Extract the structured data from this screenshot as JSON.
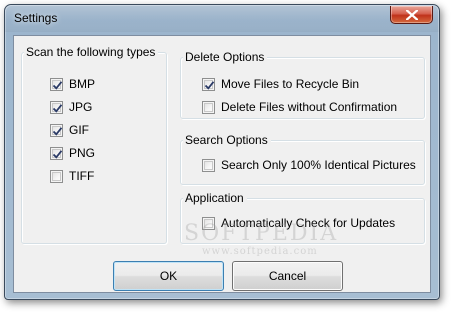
{
  "window": {
    "title": "Settings"
  },
  "types_group": {
    "label": "Scan the following types",
    "items": [
      {
        "label": "BMP",
        "checked": true
      },
      {
        "label": "JPG",
        "checked": true
      },
      {
        "label": "GIF",
        "checked": true
      },
      {
        "label": "PNG",
        "checked": true
      },
      {
        "label": "TIFF",
        "checked": false
      }
    ]
  },
  "delete_group": {
    "label": "Delete Options",
    "items": [
      {
        "label": "Move Files to Recycle Bin",
        "checked": true
      },
      {
        "label": "Delete Files without Confirmation",
        "checked": false
      }
    ]
  },
  "search_group": {
    "label": "Search Options",
    "items": [
      {
        "label": "Search Only 100% Identical Pictures",
        "checked": false
      }
    ]
  },
  "app_group": {
    "label": "Application",
    "items": [
      {
        "label": "Automatically Check for Updates",
        "checked": false
      }
    ]
  },
  "buttons": {
    "ok": "OK",
    "cancel": "Cancel"
  },
  "watermark": {
    "text": "SOFTPEDIA",
    "url": "www.softpedia.com"
  },
  "colors": {
    "close_button": "#c0321b",
    "title_bar": "#9cb5cd",
    "default_button_border": "#3c7fb1"
  }
}
